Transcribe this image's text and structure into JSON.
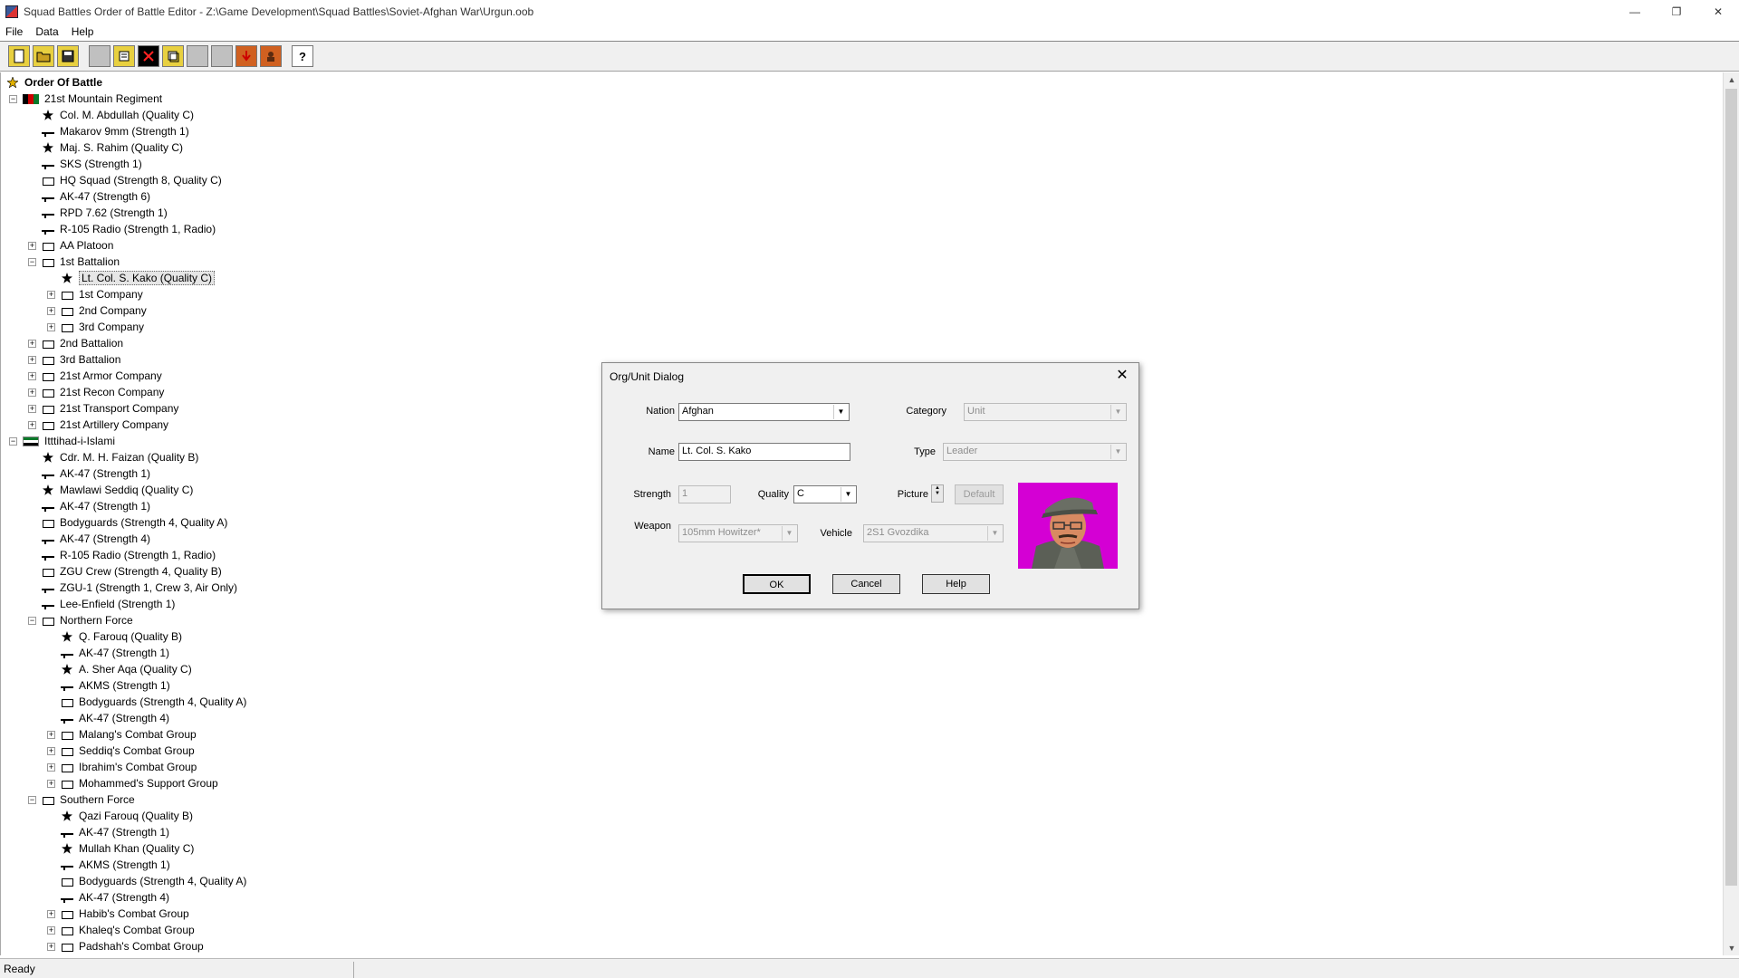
{
  "window": {
    "title": "Squad Battles Order of Battle Editor - Z:\\Game Development\\Squad Battles\\Soviet-Afghan War\\Urgun.oob",
    "minimize": "—",
    "restore": "❐",
    "close": "✕"
  },
  "menu": [
    "File",
    "Data",
    "Help"
  ],
  "toolbar": {
    "buttons": [
      "new-icon",
      "open-icon",
      "save-icon",
      "blank-1",
      "properties-icon",
      "delete-icon",
      "copy-icon",
      "blank-2",
      "blank-3",
      "import-icon",
      "leader-icon",
      "help-icon"
    ],
    "help_glyph": "?"
  },
  "tree": {
    "root": "Order Of Battle",
    "rows": [
      {
        "indent": 0,
        "exp": "-",
        "icon": "flag-afg",
        "label": "21st Mountain Regiment"
      },
      {
        "indent": 1,
        "exp": "",
        "icon": "leader",
        "label": "Col. M. Abdullah (Quality C)"
      },
      {
        "indent": 1,
        "exp": "",
        "icon": "weapon",
        "label": "Makarov 9mm (Strength 1)"
      },
      {
        "indent": 1,
        "exp": "",
        "icon": "leader",
        "label": "Maj. S. Rahim (Quality C)"
      },
      {
        "indent": 1,
        "exp": "",
        "icon": "weapon",
        "label": "SKS (Strength 1)"
      },
      {
        "indent": 1,
        "exp": "",
        "icon": "unit",
        "label": "HQ Squad (Strength 8, Quality C)"
      },
      {
        "indent": 1,
        "exp": "",
        "icon": "weapon",
        "label": "AK-47 (Strength 6)"
      },
      {
        "indent": 1,
        "exp": "",
        "icon": "weapon",
        "label": "RPD 7.62 (Strength 1)"
      },
      {
        "indent": 1,
        "exp": "",
        "icon": "weapon",
        "label": "R-105 Radio (Strength 1, Radio)"
      },
      {
        "indent": 1,
        "exp": "+",
        "icon": "unit",
        "label": "AA Platoon"
      },
      {
        "indent": 1,
        "exp": "-",
        "icon": "unit",
        "label": "1st Battalion"
      },
      {
        "indent": 2,
        "exp": "",
        "icon": "leader",
        "label": "Lt. Col. S. Kako (Quality C)",
        "selected": true
      },
      {
        "indent": 2,
        "exp": "+",
        "icon": "unit",
        "label": "1st Company"
      },
      {
        "indent": 2,
        "exp": "+",
        "icon": "unit",
        "label": "2nd Company"
      },
      {
        "indent": 2,
        "exp": "+",
        "icon": "unit",
        "label": "3rd Company"
      },
      {
        "indent": 1,
        "exp": "+",
        "icon": "unit",
        "label": "2nd Battalion"
      },
      {
        "indent": 1,
        "exp": "+",
        "icon": "unit",
        "label": "3rd Battalion"
      },
      {
        "indent": 1,
        "exp": "+",
        "icon": "unit",
        "label": "21st Armor Company"
      },
      {
        "indent": 1,
        "exp": "+",
        "icon": "unit",
        "label": "21st Recon Company"
      },
      {
        "indent": 1,
        "exp": "+",
        "icon": "unit",
        "label": "21st Transport Company"
      },
      {
        "indent": 1,
        "exp": "+",
        "icon": "unit",
        "label": "21st Artillery Company"
      },
      {
        "indent": 0,
        "exp": "-",
        "icon": "flag-itt",
        "label": "Itttihad-i-Islami"
      },
      {
        "indent": 1,
        "exp": "",
        "icon": "leader",
        "label": "Cdr. M. H. Faizan (Quality B)"
      },
      {
        "indent": 1,
        "exp": "",
        "icon": "weapon",
        "label": "AK-47 (Strength 1)"
      },
      {
        "indent": 1,
        "exp": "",
        "icon": "leader",
        "label": "Mawlawi Seddiq (Quality C)"
      },
      {
        "indent": 1,
        "exp": "",
        "icon": "weapon",
        "label": "AK-47 (Strength 1)"
      },
      {
        "indent": 1,
        "exp": "",
        "icon": "unit",
        "label": "Bodyguards (Strength 4, Quality A)"
      },
      {
        "indent": 1,
        "exp": "",
        "icon": "weapon",
        "label": "AK-47 (Strength 4)"
      },
      {
        "indent": 1,
        "exp": "",
        "icon": "weapon",
        "label": "R-105 Radio (Strength 1, Radio)"
      },
      {
        "indent": 1,
        "exp": "",
        "icon": "unit",
        "label": "ZGU Crew (Strength 4, Quality B)"
      },
      {
        "indent": 1,
        "exp": "",
        "icon": "weapon",
        "label": "ZGU-1 (Strength 1, Crew 3, Air Only)"
      },
      {
        "indent": 1,
        "exp": "",
        "icon": "weapon",
        "label": "Lee-Enfield (Strength 1)"
      },
      {
        "indent": 1,
        "exp": "-",
        "icon": "unit",
        "label": "Northern Force"
      },
      {
        "indent": 2,
        "exp": "",
        "icon": "leader",
        "label": "Q. Farouq (Quality B)"
      },
      {
        "indent": 2,
        "exp": "",
        "icon": "weapon",
        "label": "AK-47 (Strength 1)"
      },
      {
        "indent": 2,
        "exp": "",
        "icon": "leader",
        "label": "A. Sher Aqa (Quality C)"
      },
      {
        "indent": 2,
        "exp": "",
        "icon": "weapon",
        "label": "AKMS (Strength 1)"
      },
      {
        "indent": 2,
        "exp": "",
        "icon": "unit",
        "label": "Bodyguards (Strength 4, Quality A)"
      },
      {
        "indent": 2,
        "exp": "",
        "icon": "weapon",
        "label": "AK-47 (Strength 4)"
      },
      {
        "indent": 2,
        "exp": "+",
        "icon": "unit",
        "label": "Malang's Combat Group"
      },
      {
        "indent": 2,
        "exp": "+",
        "icon": "unit",
        "label": "Seddiq's Combat Group"
      },
      {
        "indent": 2,
        "exp": "+",
        "icon": "unit",
        "label": "Ibrahim's Combat Group"
      },
      {
        "indent": 2,
        "exp": "+",
        "icon": "unit",
        "label": "Mohammed's Support Group"
      },
      {
        "indent": 1,
        "exp": "-",
        "icon": "unit",
        "label": "Southern Force"
      },
      {
        "indent": 2,
        "exp": "",
        "icon": "leader",
        "label": "Qazi Farouq (Quality B)"
      },
      {
        "indent": 2,
        "exp": "",
        "icon": "weapon",
        "label": "AK-47 (Strength 1)"
      },
      {
        "indent": 2,
        "exp": "",
        "icon": "leader",
        "label": "Mullah Khan (Quality C)"
      },
      {
        "indent": 2,
        "exp": "",
        "icon": "weapon",
        "label": "AKMS (Strength 1)"
      },
      {
        "indent": 2,
        "exp": "",
        "icon": "unit",
        "label": "Bodyguards (Strength 4, Quality A)"
      },
      {
        "indent": 2,
        "exp": "",
        "icon": "weapon",
        "label": "AK-47 (Strength 4)"
      },
      {
        "indent": 2,
        "exp": "+",
        "icon": "unit",
        "label": "Habib's Combat Group"
      },
      {
        "indent": 2,
        "exp": "+",
        "icon": "unit",
        "label": "Khaleq's Combat Group"
      },
      {
        "indent": 2,
        "exp": "+",
        "icon": "unit",
        "label": "Padshah's Combat Group"
      }
    ]
  },
  "status": {
    "text": "Ready"
  },
  "dialog": {
    "title": "Org/Unit Dialog",
    "close": "✕",
    "nation_label": "Nation",
    "nation_value": "Afghan",
    "category_label": "Category",
    "category_value": "Unit",
    "name_label": "Name",
    "name_value": "Lt. Col. S. Kako",
    "type_label": "Type",
    "type_value": "Leader",
    "strength_label": "Strength",
    "strength_value": "1",
    "quality_label": "Quality",
    "quality_value": "C",
    "picture_label": "Picture",
    "default_label": "Default",
    "weapon_label": "Weapon",
    "weapon_value": "105mm Howitzer*",
    "vehicle_label": "Vehicle",
    "vehicle_value": "2S1 Gvozdika",
    "ok_label": "OK",
    "cancel_label": "Cancel",
    "help_label": "Help"
  },
  "colors": {
    "portrait_bg": "#d400d4",
    "selection": "#e6e6e6"
  }
}
